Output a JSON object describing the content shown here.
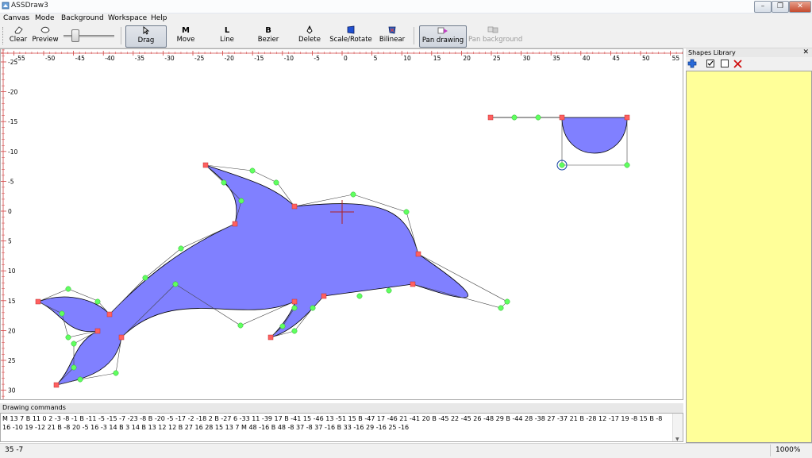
{
  "window": {
    "title": "ASSDraw3",
    "minimize": "–",
    "restore": "❐",
    "close": "✕"
  },
  "menu": {
    "items": [
      "Canvas",
      "Mode",
      "Background",
      "Workspace",
      "Help"
    ]
  },
  "toolbar": {
    "clear": "Clear",
    "preview": "Preview",
    "drag": "Drag",
    "move": "Move",
    "line": "Line",
    "bezier": "Bezier",
    "delete": "Delete",
    "scale_rotate": "Scale/Rotate",
    "bilinear": "Bilinear",
    "pan_drawing": "Pan drawing",
    "pan_background": "Pan background",
    "move_icon_text": "M",
    "line_icon_text": "L",
    "bezier_icon_text": "B"
  },
  "ruler": {
    "x_ticks": [
      "-55",
      "-50",
      "-45",
      "-40",
      "-35",
      "-30",
      "-25",
      "-20",
      "-15",
      "-10",
      "-5",
      "0",
      "5",
      "10",
      "15",
      "20",
      "25",
      "30",
      "35",
      "40",
      "45",
      "50",
      "55"
    ],
    "y_ticks": [
      "-25",
      "-20",
      "-15",
      "-10",
      "-5",
      "0",
      "5",
      "10",
      "15",
      "20",
      "25",
      "30"
    ]
  },
  "shapes_library": {
    "title": "Shapes Library",
    "close": "✕"
  },
  "drawing_commands": {
    "label": "Drawing commands",
    "text": "M 13 7 B 11 0 2 -3 -8 -1 B -11 -5 -15 -7 -23 -8 B -20 -5 -17 -2 -18 2 B -27 6 -33 11 -39 17 B -41 15 -46 13 -51 15 B -47 17 -46 21 -41 20 B -45 22 -45 26 -48 29 B -44 28 -38 27 -37 21 B -28 12 -17 19 -8 15 B -8 16 -10 19 -12 21 B -8 20 -5 16 -3 14 B 3 14 B 13 12 12 B 27 16 28 15 13 7 M 48 -16 B 48 -8 37 -8 37 -16 B 33 -16 29 -16 25 -16"
  },
  "status": {
    "coords": "35  -7",
    "zoom": "1000%"
  },
  "colors": {
    "fill": "#8080ff",
    "point": "#ff6060",
    "control": "#60ff60",
    "library_bg": "#ffff99",
    "ruler": "#d04040"
  }
}
